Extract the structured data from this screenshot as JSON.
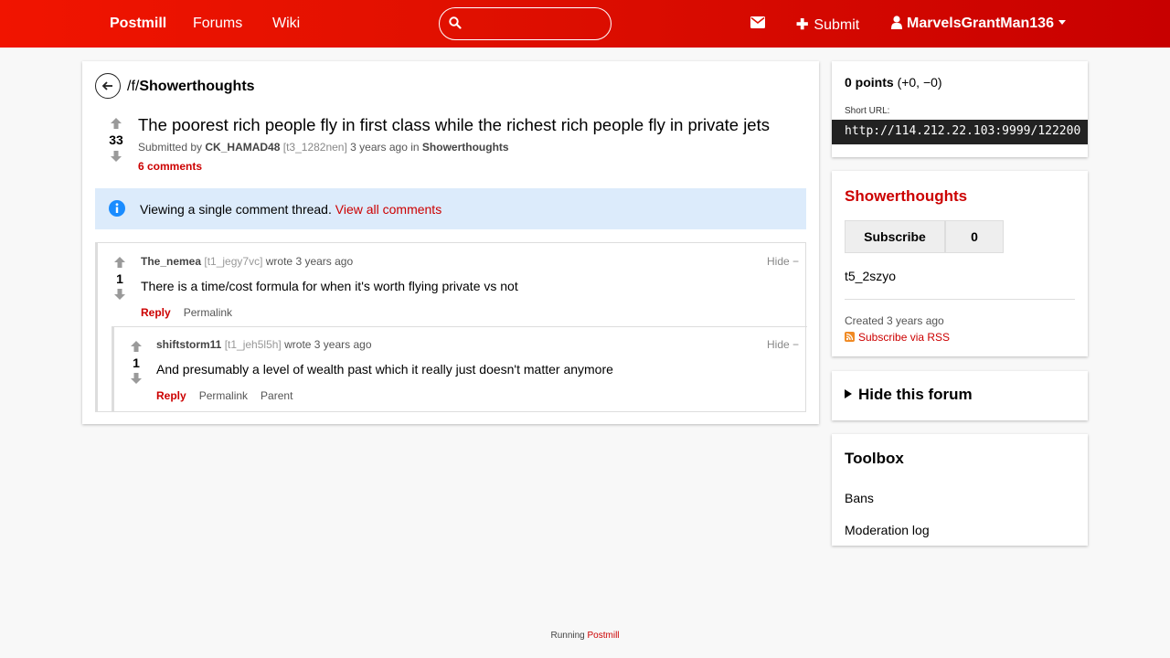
{
  "nav": {
    "brand": "Postmill",
    "forums": "Forums",
    "wiki": "Wiki",
    "search_placeholder": "",
    "submit": "Submit",
    "user": "MarvelsGrantMan136"
  },
  "post": {
    "breadcrumb_prefix": "/f/",
    "forum": "Showerthoughts",
    "score": "33",
    "title": "The poorest rich people fly in first class while the richest rich people fly in private jets",
    "submitted_by": "Submitted by",
    "author": "CK_HAMAD48",
    "id": "[t3_1282nen]",
    "time": "3 years ago in",
    "comments": "6 comments"
  },
  "info": {
    "text": "Viewing a single comment thread.",
    "link": "View all comments"
  },
  "comments": [
    {
      "author": "The_nemea",
      "id": "[t1_jegy7vc]",
      "wrote": "wrote 3 years ago",
      "score": "1",
      "hide": "Hide −",
      "body": "There is a time/cost formula for when it's worth flying private vs not",
      "reply": "Reply",
      "permalink": "Permalink"
    },
    {
      "author": "shiftstorm11",
      "id": "[t1_jeh5l5h]",
      "wrote": "wrote 3 years ago",
      "score": "1",
      "hide": "Hide −",
      "body": "And presumably a level of wealth past which it really just doesn't matter anymore",
      "reply": "Reply",
      "permalink": "Permalink",
      "parent": "Parent"
    }
  ],
  "sidebar": {
    "points": "0 points",
    "points_detail": "(+0, −0)",
    "short_url_label": "Short URL:",
    "short_url": "http://114.212.22.103:9999/122200",
    "forum_name": "Showerthoughts",
    "subscribe": "Subscribe",
    "subscriber_count": "0",
    "forum_id": "t5_2szyo",
    "created": "Created 3 years ago",
    "rss": "Subscribe via RSS",
    "hide_forum": "Hide this forum",
    "toolbox_title": "Toolbox",
    "bans": "Bans",
    "modlog": "Moderation log"
  },
  "footer": {
    "text": "Running",
    "link": "Postmill"
  },
  "colors": {
    "accent": "#cc0000",
    "navbar": "#e01000",
    "info_bg": "#dcebfb"
  }
}
